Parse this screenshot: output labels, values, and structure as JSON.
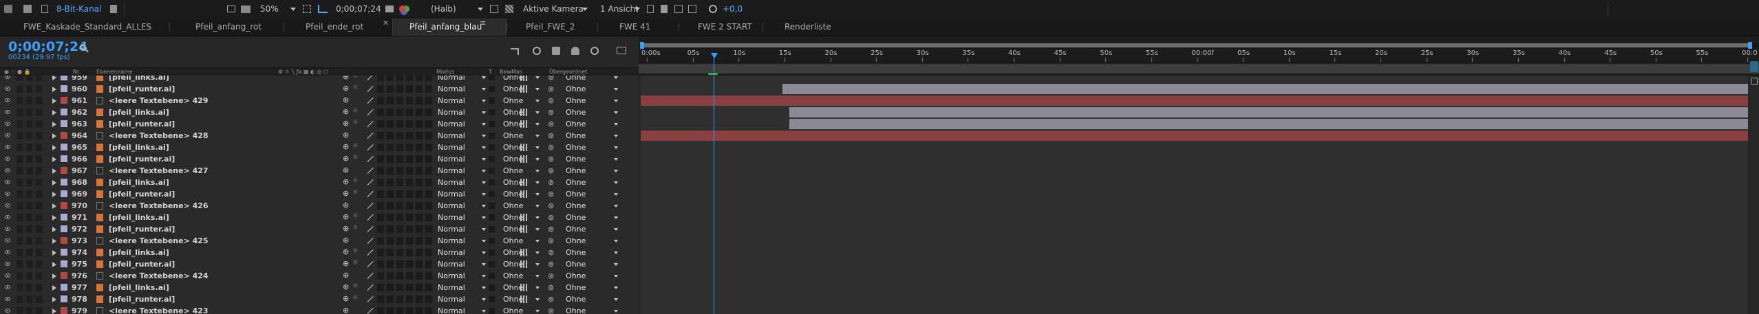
{
  "toolbar": {
    "bit_depth": "8-Bit-Kanal",
    "zoom": "50%",
    "timecode": "0;00;07;24",
    "resolution": "(Halb)",
    "camera": "Aktive Kamera",
    "view": "1 Ansicht",
    "exposure": "+0,0"
  },
  "tabs": [
    {
      "label": "FWE_Kaskade_Standard_ALLES"
    },
    {
      "label": "Pfeil_anfang_rot"
    },
    {
      "label": "Pfeil_ende_rot"
    },
    {
      "label": "Pfeil_anfang_blau",
      "active": true
    },
    {
      "label": "Pfeil_FWE_2"
    },
    {
      "label": "FWE 41"
    },
    {
      "label": "FWE 2 START"
    },
    {
      "label": "Renderliste"
    }
  ],
  "timeline": {
    "current_time": "0;00;07;24",
    "frames": "00234 (29.97 fps)",
    "search_icon": "search-icon"
  },
  "columns": {
    "nr": "Nr.",
    "name": "Ebenenname",
    "mode": "Modus",
    "t": "T",
    "track_matte": "BewMas",
    "parent": "Übergeordnet"
  },
  "ruler": [
    "0:00s",
    "05s",
    "10s",
    "15s",
    "20s",
    "25s",
    "30s",
    "35s",
    "40s",
    "45s",
    "50s",
    "55s",
    "00:00f",
    "05s",
    "10s",
    "15s",
    "20s",
    "25s",
    "30s",
    "35s",
    "40s",
    "45s",
    "50s",
    "55s",
    "00:0"
  ],
  "colors": {
    "red_label": "#b04848",
    "lavender_label": "#a9a9cc",
    "orange_icon": "#d8743a",
    "red_bar": "#8a4040",
    "gray_bar": "#8c8a96",
    "playhead": "#3aa0ff"
  },
  "layers": [
    {
      "num": "959",
      "name": "[pfeil_links.ai]",
      "label": "lavender",
      "type": "ai",
      "mode": "Normal",
      "trk": "Ohne",
      "parent": "Ohne"
    },
    {
      "num": "960",
      "name": "[pfeil_runter.ai]",
      "label": "lavender",
      "type": "ai",
      "mode": "Normal",
      "trk": "Ohne",
      "parent": "Ohne",
      "bar": "gray",
      "bar_start": 0.128,
      "bar_end": 1.0
    },
    {
      "num": "961",
      "name": "<leere Textebene> 429",
      "label": "red",
      "type": "text",
      "mode": "Normal",
      "trk": "Ohne",
      "parent": "Ohne",
      "bar": "red",
      "bar_start": 0.0,
      "bar_end": 1.0
    },
    {
      "num": "962",
      "name": "[pfeil_links.ai]",
      "label": "lavender",
      "type": "ai",
      "mode": "Normal",
      "trk": "Ohne",
      "parent": "Ohne",
      "bar": "gray",
      "bar_start": 0.134,
      "bar_end": 1.0
    },
    {
      "num": "963",
      "name": "[pfeil_runter.ai]",
      "label": "lavender",
      "type": "ai",
      "mode": "Normal",
      "trk": "Ohne",
      "parent": "Ohne",
      "bar": "gray",
      "bar_start": 0.134,
      "bar_end": 1.0
    },
    {
      "num": "964",
      "name": "<leere Textebene> 428",
      "label": "red",
      "type": "text",
      "mode": "Normal",
      "trk": "Ohne",
      "parent": "Ohne",
      "bar": "red",
      "bar_start": 0.0,
      "bar_end": 1.0
    },
    {
      "num": "965",
      "name": "[pfeil_links.ai]",
      "label": "lavender",
      "type": "ai",
      "mode": "Normal",
      "trk": "Ohne",
      "parent": "Ohne"
    },
    {
      "num": "966",
      "name": "[pfeil_runter.ai]",
      "label": "lavender",
      "type": "ai",
      "mode": "Normal",
      "trk": "Ohne",
      "parent": "Ohne"
    },
    {
      "num": "967",
      "name": "<leere Textebene> 427",
      "label": "red",
      "type": "text",
      "mode": "Normal",
      "trk": "Ohne",
      "parent": "Ohne"
    },
    {
      "num": "968",
      "name": "[pfeil_links.ai]",
      "label": "lavender",
      "type": "ai",
      "mode": "Normal",
      "trk": "Ohne",
      "parent": "Ohne"
    },
    {
      "num": "969",
      "name": "[pfeil_runter.ai]",
      "label": "lavender",
      "type": "ai",
      "mode": "Normal",
      "trk": "Ohne",
      "parent": "Ohne"
    },
    {
      "num": "970",
      "name": "<leere Textebene> 426",
      "label": "red",
      "type": "text",
      "mode": "Normal",
      "trk": "Ohne",
      "parent": "Ohne"
    },
    {
      "num": "971",
      "name": "[pfeil_links.ai]",
      "label": "lavender",
      "type": "ai",
      "mode": "Normal",
      "trk": "Ohne",
      "parent": "Ohne"
    },
    {
      "num": "972",
      "name": "[pfeil_runter.ai]",
      "label": "lavender",
      "type": "ai",
      "mode": "Normal",
      "trk": "Ohne",
      "parent": "Ohne"
    },
    {
      "num": "973",
      "name": "<leere Textebene> 425",
      "label": "red",
      "type": "text",
      "mode": "Normal",
      "trk": "Ohne",
      "parent": "Ohne"
    },
    {
      "num": "974",
      "name": "[pfeil_links.ai]",
      "label": "lavender",
      "type": "ai",
      "mode": "Normal",
      "trk": "Ohne",
      "parent": "Ohne"
    },
    {
      "num": "975",
      "name": "[pfeil_runter.ai]",
      "label": "lavender",
      "type": "ai",
      "mode": "Normal",
      "trk": "Ohne",
      "parent": "Ohne"
    },
    {
      "num": "976",
      "name": "<leere Textebene> 424",
      "label": "red",
      "type": "text",
      "mode": "Normal",
      "trk": "Ohne",
      "parent": "Ohne"
    },
    {
      "num": "977",
      "name": "[pfeil_links.ai]",
      "label": "lavender",
      "type": "ai",
      "mode": "Normal",
      "trk": "Ohne",
      "parent": "Ohne"
    },
    {
      "num": "978",
      "name": "[pfeil_runter.ai]",
      "label": "lavender",
      "type": "ai",
      "mode": "Normal",
      "trk": "Ohne",
      "parent": "Ohne"
    },
    {
      "num": "979",
      "name": "<leere Textebene> 423",
      "label": "red",
      "type": "text",
      "mode": "Normal",
      "trk": "Ohne",
      "parent": "Ohne"
    }
  ]
}
